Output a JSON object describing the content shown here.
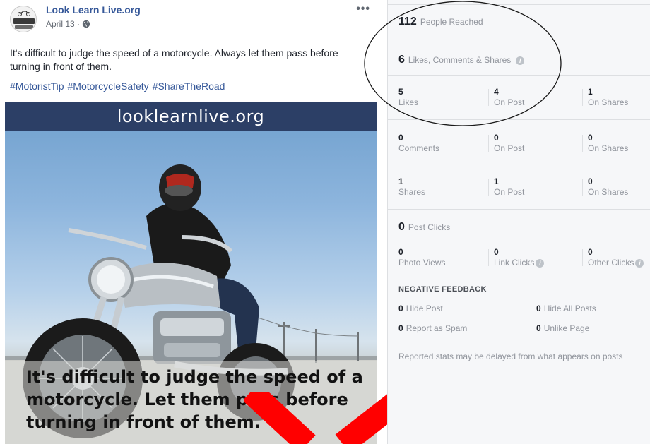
{
  "post": {
    "page_name": "Look Learn Live.org",
    "date": "April 13 ·",
    "privacy_icon": "globe-icon",
    "more_icon": "more-options-icon",
    "text": "It's difficult to judge the speed of a motorcycle. Always let them pass before turning in front of them.",
    "hashtags": [
      "#MotoristTip",
      "#MotorcycleSafety",
      "#ShareTheRoad"
    ],
    "image": {
      "banner": "looklearnlive.org",
      "caption": "It's difficult to judge the speed of a motorcycle. Let them pass before turning in front of them."
    }
  },
  "insights": {
    "reach": {
      "value": "112",
      "label": "People Reached"
    },
    "engagement": {
      "value": "6",
      "label": "Likes, Comments & Shares"
    },
    "likes": [
      {
        "value": "5",
        "label": "Likes"
      },
      {
        "value": "4",
        "label": "On Post"
      },
      {
        "value": "1",
        "label": "On Shares"
      }
    ],
    "comments": [
      {
        "value": "0",
        "label": "Comments"
      },
      {
        "value": "0",
        "label": "On Post"
      },
      {
        "value": "0",
        "label": "On Shares"
      }
    ],
    "shares": [
      {
        "value": "1",
        "label": "Shares"
      },
      {
        "value": "1",
        "label": "On Post"
      },
      {
        "value": "0",
        "label": "On Shares"
      }
    ],
    "post_clicks": {
      "value": "0",
      "label": "Post Clicks"
    },
    "clicks": [
      {
        "value": "0",
        "label": "Photo Views"
      },
      {
        "value": "0",
        "label": "Link Clicks"
      },
      {
        "value": "0",
        "label": "Other Clicks"
      }
    ],
    "negative_feedback": {
      "title": "NEGATIVE FEEDBACK",
      "items": [
        {
          "value": "0",
          "label": "Hide Post"
        },
        {
          "value": "0",
          "label": "Hide All Posts"
        },
        {
          "value": "0",
          "label": "Report as Spam"
        },
        {
          "value": "0",
          "label": "Unlike Page"
        }
      ]
    },
    "footnote": "Reported stats may be delayed from what appears on posts"
  },
  "colors": {
    "link": "#365899",
    "muted": "#90949c",
    "banner": "#2c3f66",
    "x_mark": "#ff0000"
  }
}
